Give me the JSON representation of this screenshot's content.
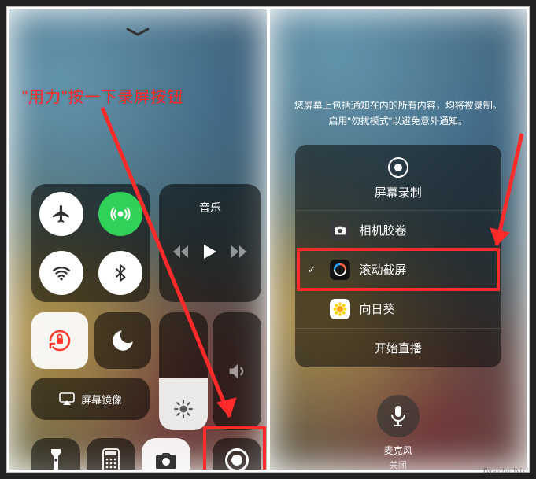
{
  "annotation": {
    "left_text": "\"用力\"按一下录屏按钮"
  },
  "control_center": {
    "music": {
      "title": "音乐"
    },
    "mirror": {
      "label": "屏幕镜像"
    }
  },
  "screen_record_sheet": {
    "desc_line1": "您屏幕上包括通知在内的所有内容，均将被录制。",
    "desc_line2": "启用\"勿扰模式\"以避免意外通知。",
    "title": "屏幕录制",
    "rows": [
      {
        "icon": "camera-roll",
        "label": "相机胶卷",
        "checked": false
      },
      {
        "icon": "scroll-shot",
        "label": "滚动截屏",
        "checked": true
      },
      {
        "icon": "sunflower",
        "label": "向日葵",
        "checked": false
      }
    ],
    "start_live": "开始直播",
    "mic": {
      "label": "麦克风",
      "state": "关闭"
    }
  },
  "watermark": "Typecho.Wiki"
}
